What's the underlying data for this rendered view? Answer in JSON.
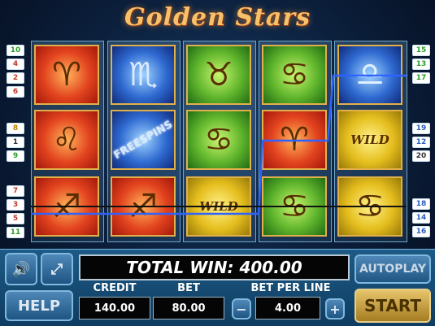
{
  "title": "Golden Stars",
  "line_numbers": {
    "left_top": [
      "10",
      "4",
      "2",
      "6"
    ],
    "left_middle": [
      "8",
      "1",
      "9"
    ],
    "left_bottom": [
      "7",
      "3",
      "5",
      "11"
    ],
    "right_top": [
      "15",
      "13",
      "17"
    ],
    "right_middle": [
      "19",
      "12",
      "20"
    ],
    "right_bottom": [
      "18",
      "14",
      "16"
    ]
  },
  "reels": [
    [
      {
        "symbol": "aries-icon",
        "glyph": "♈",
        "color": "red"
      },
      {
        "symbol": "leo-icon",
        "glyph": "♌",
        "color": "red"
      },
      {
        "symbol": "sagittarius-icon",
        "glyph": "♐",
        "color": "red"
      }
    ],
    [
      {
        "symbol": "scorpio-icon",
        "glyph": "♏",
        "color": "blue"
      },
      {
        "symbol": "free-spins-icon",
        "text": "FREESPINS",
        "color": "blue"
      },
      {
        "symbol": "sagittarius-icon",
        "glyph": "♐",
        "color": "red"
      }
    ],
    [
      {
        "symbol": "taurus-icon",
        "glyph": "♉",
        "color": "green"
      },
      {
        "symbol": "cancer-icon",
        "glyph": "♋",
        "color": "green"
      },
      {
        "symbol": "wild-icon",
        "text": "WILD",
        "color": "yellow"
      }
    ],
    [
      {
        "symbol": "cancer-icon",
        "glyph": "♋",
        "color": "green"
      },
      {
        "symbol": "aries-icon",
        "glyph": "♈",
        "color": "red"
      },
      {
        "symbol": "cancer-icon",
        "glyph": "♋",
        "color": "green"
      }
    ],
    [
      {
        "symbol": "libra-icon",
        "glyph": "♎",
        "color": "blue"
      },
      {
        "symbol": "wild-icon",
        "text": "WILD",
        "color": "yellow"
      },
      {
        "symbol": "cancer-icon",
        "glyph": "♋",
        "color": "yellow"
      }
    ]
  ],
  "controls": {
    "total_win_label": "TOTAL WIN:",
    "total_win_value": "400.00",
    "credit_label": "CREDIT",
    "credit_value": "140.00",
    "bet_label": "BET",
    "bet_value": "80.00",
    "bet_per_line_label": "BET PER LINE",
    "bet_per_line_value": "4.00",
    "help_label": "HELP",
    "autoplay_label": "AUTOPLAY",
    "start_label": "START",
    "minus_label": "−",
    "plus_label": "+"
  },
  "colors": {
    "title": "#f5c26b",
    "panel": "#1d5a86",
    "start_button": "#c8a040",
    "payline_blue": "#2f62ff",
    "payline_black": "#111111"
  }
}
